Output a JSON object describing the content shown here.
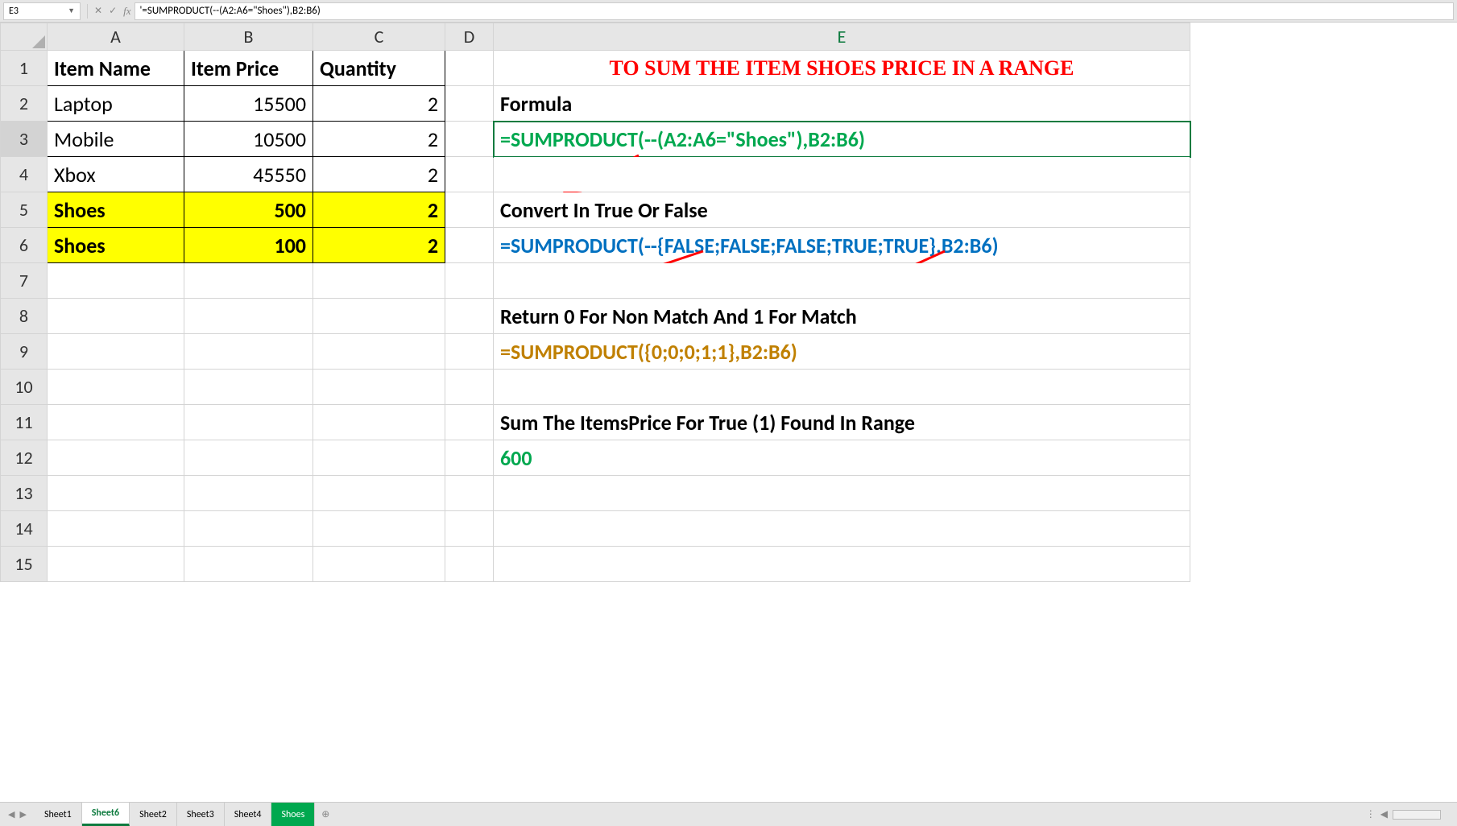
{
  "formulaBar": {
    "cellRef": "E3",
    "formula": "'=SUMPRODUCT(--(A2:A6=\"Shoes\"),B2:B6)"
  },
  "columns": [
    "A",
    "B",
    "C",
    "D",
    "E"
  ],
  "rows": [
    "1",
    "2",
    "3",
    "4",
    "5",
    "6",
    "7",
    "8",
    "9",
    "10",
    "11",
    "12",
    "13",
    "14",
    "15"
  ],
  "headers": {
    "A": "Item Name",
    "B": "Item Price",
    "C": "Quantity"
  },
  "data": [
    {
      "name": "Laptop",
      "price": "15500",
      "qty": "2",
      "hl": false
    },
    {
      "name": "Mobile",
      "price": "10500",
      "qty": "2",
      "hl": false
    },
    {
      "name": "Xbox",
      "price": "45550",
      "qty": "2",
      "hl": false
    },
    {
      "name": "Shoes",
      "price": "500",
      "qty": "2",
      "hl": true
    },
    {
      "name": "Shoes",
      "price": "100",
      "qty": "2",
      "hl": true
    }
  ],
  "colE": {
    "title": "TO SUM THE ITEM SHOES PRICE IN A RANGE",
    "r2": "Formula",
    "r3": "=SUMPRODUCT(--(A2:A6=\"Shoes\"),B2:B6)",
    "r5": "Convert In True Or False",
    "r6": "=SUMPRODUCT(--{FALSE;FALSE;FALSE;TRUE;TRUE},B2:B6)",
    "r8": "Return 0 For Non Match And 1 For Match",
    "r9": "=SUMPRODUCT({0;0;0;1;1},B2:B6)",
    "r11": "Sum The ItemsPrice For True (1) Found In Range",
    "r12": "600"
  },
  "tabs": [
    "Sheet1",
    "Sheet6",
    "Sheet2",
    "Sheet3",
    "Sheet4",
    "Shoes"
  ],
  "activeTab": "Sheet6",
  "greenTab": "Shoes",
  "activeRow": "3",
  "icons": {
    "cancel": "✕",
    "accept": "✓",
    "fx": "fx",
    "plus": "⊕",
    "left": "◀",
    "right": "▶",
    "dots": "⋮"
  }
}
